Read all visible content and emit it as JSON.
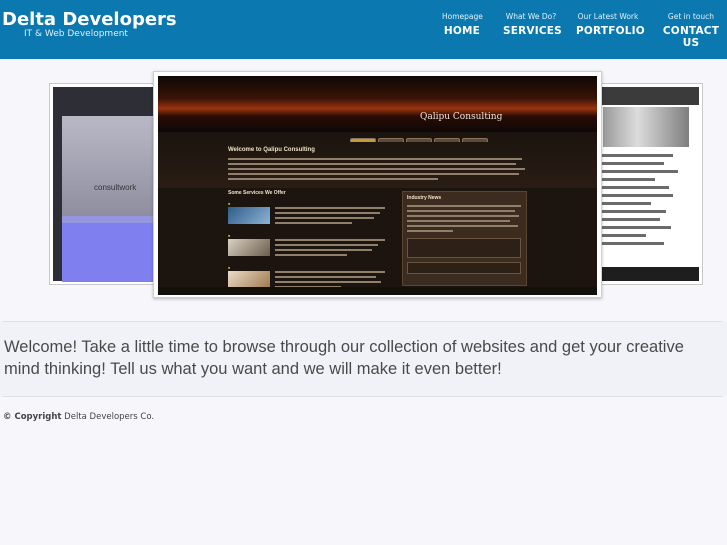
{
  "brand": {
    "title": "Delta Developers",
    "subtitle": "IT & Web Development"
  },
  "nav": [
    {
      "sub": "Homepage",
      "label": "HOME"
    },
    {
      "sub": "What We Do?",
      "label": "SERVICES"
    },
    {
      "sub": "Our Latest Work",
      "label": "PORTFOLIO"
    },
    {
      "sub": "Get in touch",
      "label": "CONTACT US"
    }
  ],
  "slideshow": {
    "left_card_text": "consultwork",
    "featured": {
      "site_title": "Qalipu Consulting",
      "welcome_heading": "Welcome to Qalipu Consulting",
      "services_heading": "Some Services We Offer",
      "news_heading": "Industry News"
    }
  },
  "welcome": {
    "text": "Welcome! Take a little time to browse through our collection of websites and get your creative mind thinking! Tell us what you want and we will make it even better!"
  },
  "footer": {
    "copyright_label": "© Copyright",
    "company": "Delta Developers Co."
  },
  "colors": {
    "header_bg": "#0b78b0",
    "page_bg": "#f7f7fb",
    "welcome_bg": "#f1f2f8"
  }
}
